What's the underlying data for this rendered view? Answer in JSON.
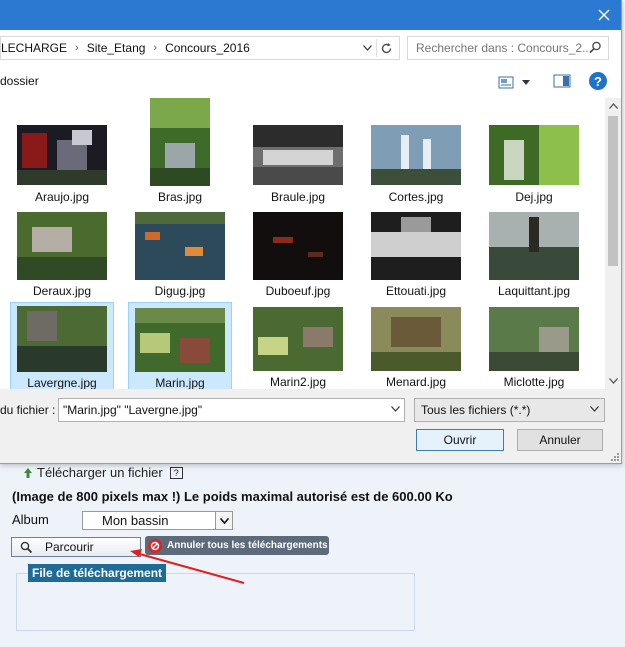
{
  "dialog": {
    "title": "",
    "breadcrumb": [
      "LECHARGE",
      "Site_Etang",
      "Concours_2016"
    ],
    "search_placeholder": "Rechercher dans : Concours_2...",
    "new_folder_label": "dossier",
    "files": [
      {
        "name": "Araujo.jpg",
        "selected": false
      },
      {
        "name": "Bras.jpg",
        "selected": false
      },
      {
        "name": "Braule.jpg",
        "selected": false
      },
      {
        "name": "Cortes.jpg",
        "selected": false
      },
      {
        "name": "Dej.jpg",
        "selected": false
      },
      {
        "name": "Deraux.jpg",
        "selected": false
      },
      {
        "name": "Digug.jpg",
        "selected": false
      },
      {
        "name": "Duboeuf.jpg",
        "selected": false
      },
      {
        "name": "Ettouati.jpg",
        "selected": false
      },
      {
        "name": "Laquittant.jpg",
        "selected": false
      },
      {
        "name": "Lavergne.jpg",
        "selected": true
      },
      {
        "name": "Marin.jpg",
        "selected": true
      },
      {
        "name": "Marin2.jpg",
        "selected": false
      },
      {
        "name": "Menard.jpg",
        "selected": false
      },
      {
        "name": "Miclotte.jpg",
        "selected": false
      }
    ],
    "filename_label": "du fichier :",
    "filename_value": "\"Marin.jpg\" \"Lavergne.jpg\"",
    "filetype_value": "Tous les fichiers (*.*)",
    "open_label": "Ouvrir",
    "cancel_label": "Annuler"
  },
  "page": {
    "upload_link": "Télécharger un fichier",
    "help_mark": "?",
    "limit_text": "(Image de 800 pixels max !) Le poids maximal autorisé est de 600.00 Ko",
    "album_label": "Album",
    "album_value": "Mon bassin",
    "browse_label": "Parcourir",
    "cancel_all_label": "Annuler tous les téléchargements",
    "queue_label": "File de téléchargement"
  },
  "colors": {
    "titlebar": "#2b79d0",
    "selection": "#cce8ff",
    "queue_label_bg": "#1f6b97",
    "annotation_arrow": "#e02020"
  }
}
